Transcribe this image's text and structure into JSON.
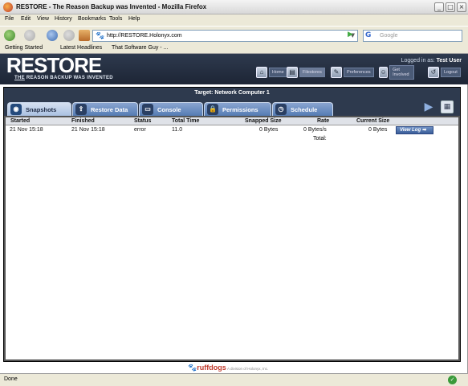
{
  "window": {
    "title": "RESTORE - The Reason Backup was Invented - Mozilla Firefox"
  },
  "menu": [
    "File",
    "Edit",
    "View",
    "History",
    "Bookmarks",
    "Tools",
    "Help"
  ],
  "navbar": {
    "url": "http://RESTORE.Holonyx.com",
    "search_placeholder": "Google"
  },
  "bookmarks": [
    "Getting Started",
    "Latest Headlines",
    "That Software Guy - ..."
  ],
  "header": {
    "logo_prefix": "RE",
    "logo_suffix": "STORE",
    "tagline_emph": "THE",
    "tagline_rest": "REASON BACKUP WAS INVENTED",
    "logged_in_label": "Logged in as:",
    "user": "Test User",
    "nav": [
      {
        "label": "Home",
        "icon": "home-icon"
      },
      {
        "label": "Filestores",
        "icon": "folder-icon"
      },
      {
        "label": "Preferences",
        "icon": "wrench-icon"
      },
      {
        "label": "Get Involved",
        "icon": "people-icon"
      },
      {
        "label": "Logout",
        "icon": "logout-icon"
      }
    ]
  },
  "target": "Target: Network Computer 1",
  "tabs": [
    {
      "label": "Snapshots",
      "active": true
    },
    {
      "label": "Restore Data",
      "active": false
    },
    {
      "label": "Console",
      "active": false
    },
    {
      "label": "Permissions",
      "active": false
    },
    {
      "label": "Schedule",
      "active": false
    }
  ],
  "table": {
    "columns": [
      "Started",
      "Finished",
      "Status",
      "Total Time",
      "Snapped Size",
      "Rate",
      "Current Size"
    ],
    "rows": [
      {
        "started": "21 Nov 15:18",
        "finished": "21 Nov 15:18",
        "status": "error",
        "total_time": "11.0",
        "snapped_size": "0 Bytes",
        "rate": "0 Bytes/s",
        "current_size": "0 Bytes",
        "action": "View Log"
      }
    ],
    "total_label": "Total:"
  },
  "footer": {
    "brand": "ruffdogs",
    "sub": "A division of Holonyx, Inc."
  },
  "status": "Done",
  "colors": {
    "header_bg": "#2e3a4e",
    "tab_active": "#aac1e2",
    "tab_inactive": "#557cb4",
    "brand_red": "#c0392b"
  }
}
